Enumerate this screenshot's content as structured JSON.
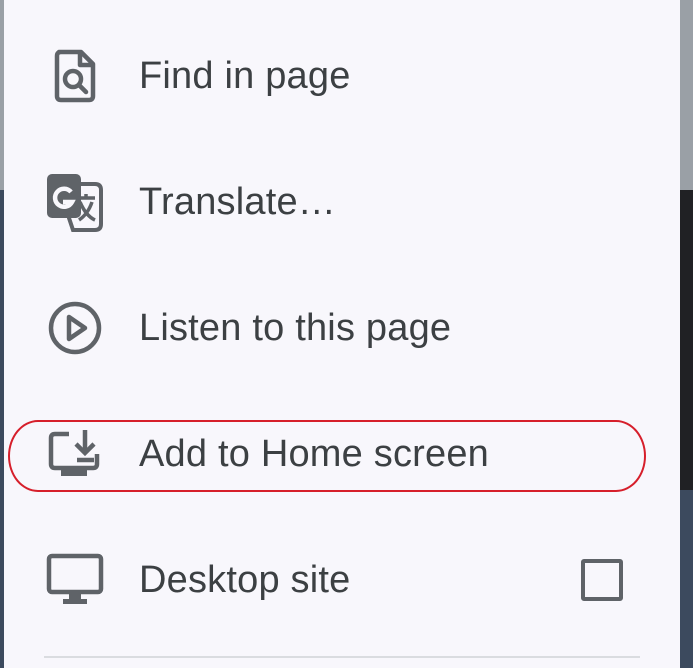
{
  "menu": {
    "items": [
      {
        "label": "Find in page",
        "icon": "find-in-page-icon"
      },
      {
        "label": "Translate…",
        "icon": "translate-icon"
      },
      {
        "label": "Listen to this page",
        "icon": "play-circle-icon"
      },
      {
        "label": "Add to Home screen",
        "icon": "add-to-home-screen-icon"
      },
      {
        "label": "Desktop site",
        "icon": "desktop-icon",
        "checked": false
      }
    ]
  },
  "colors": {
    "menu_background": "#f8f7fc",
    "icon": "#5f6368",
    "text": "#3c4043",
    "highlight": "#d61f2b"
  }
}
